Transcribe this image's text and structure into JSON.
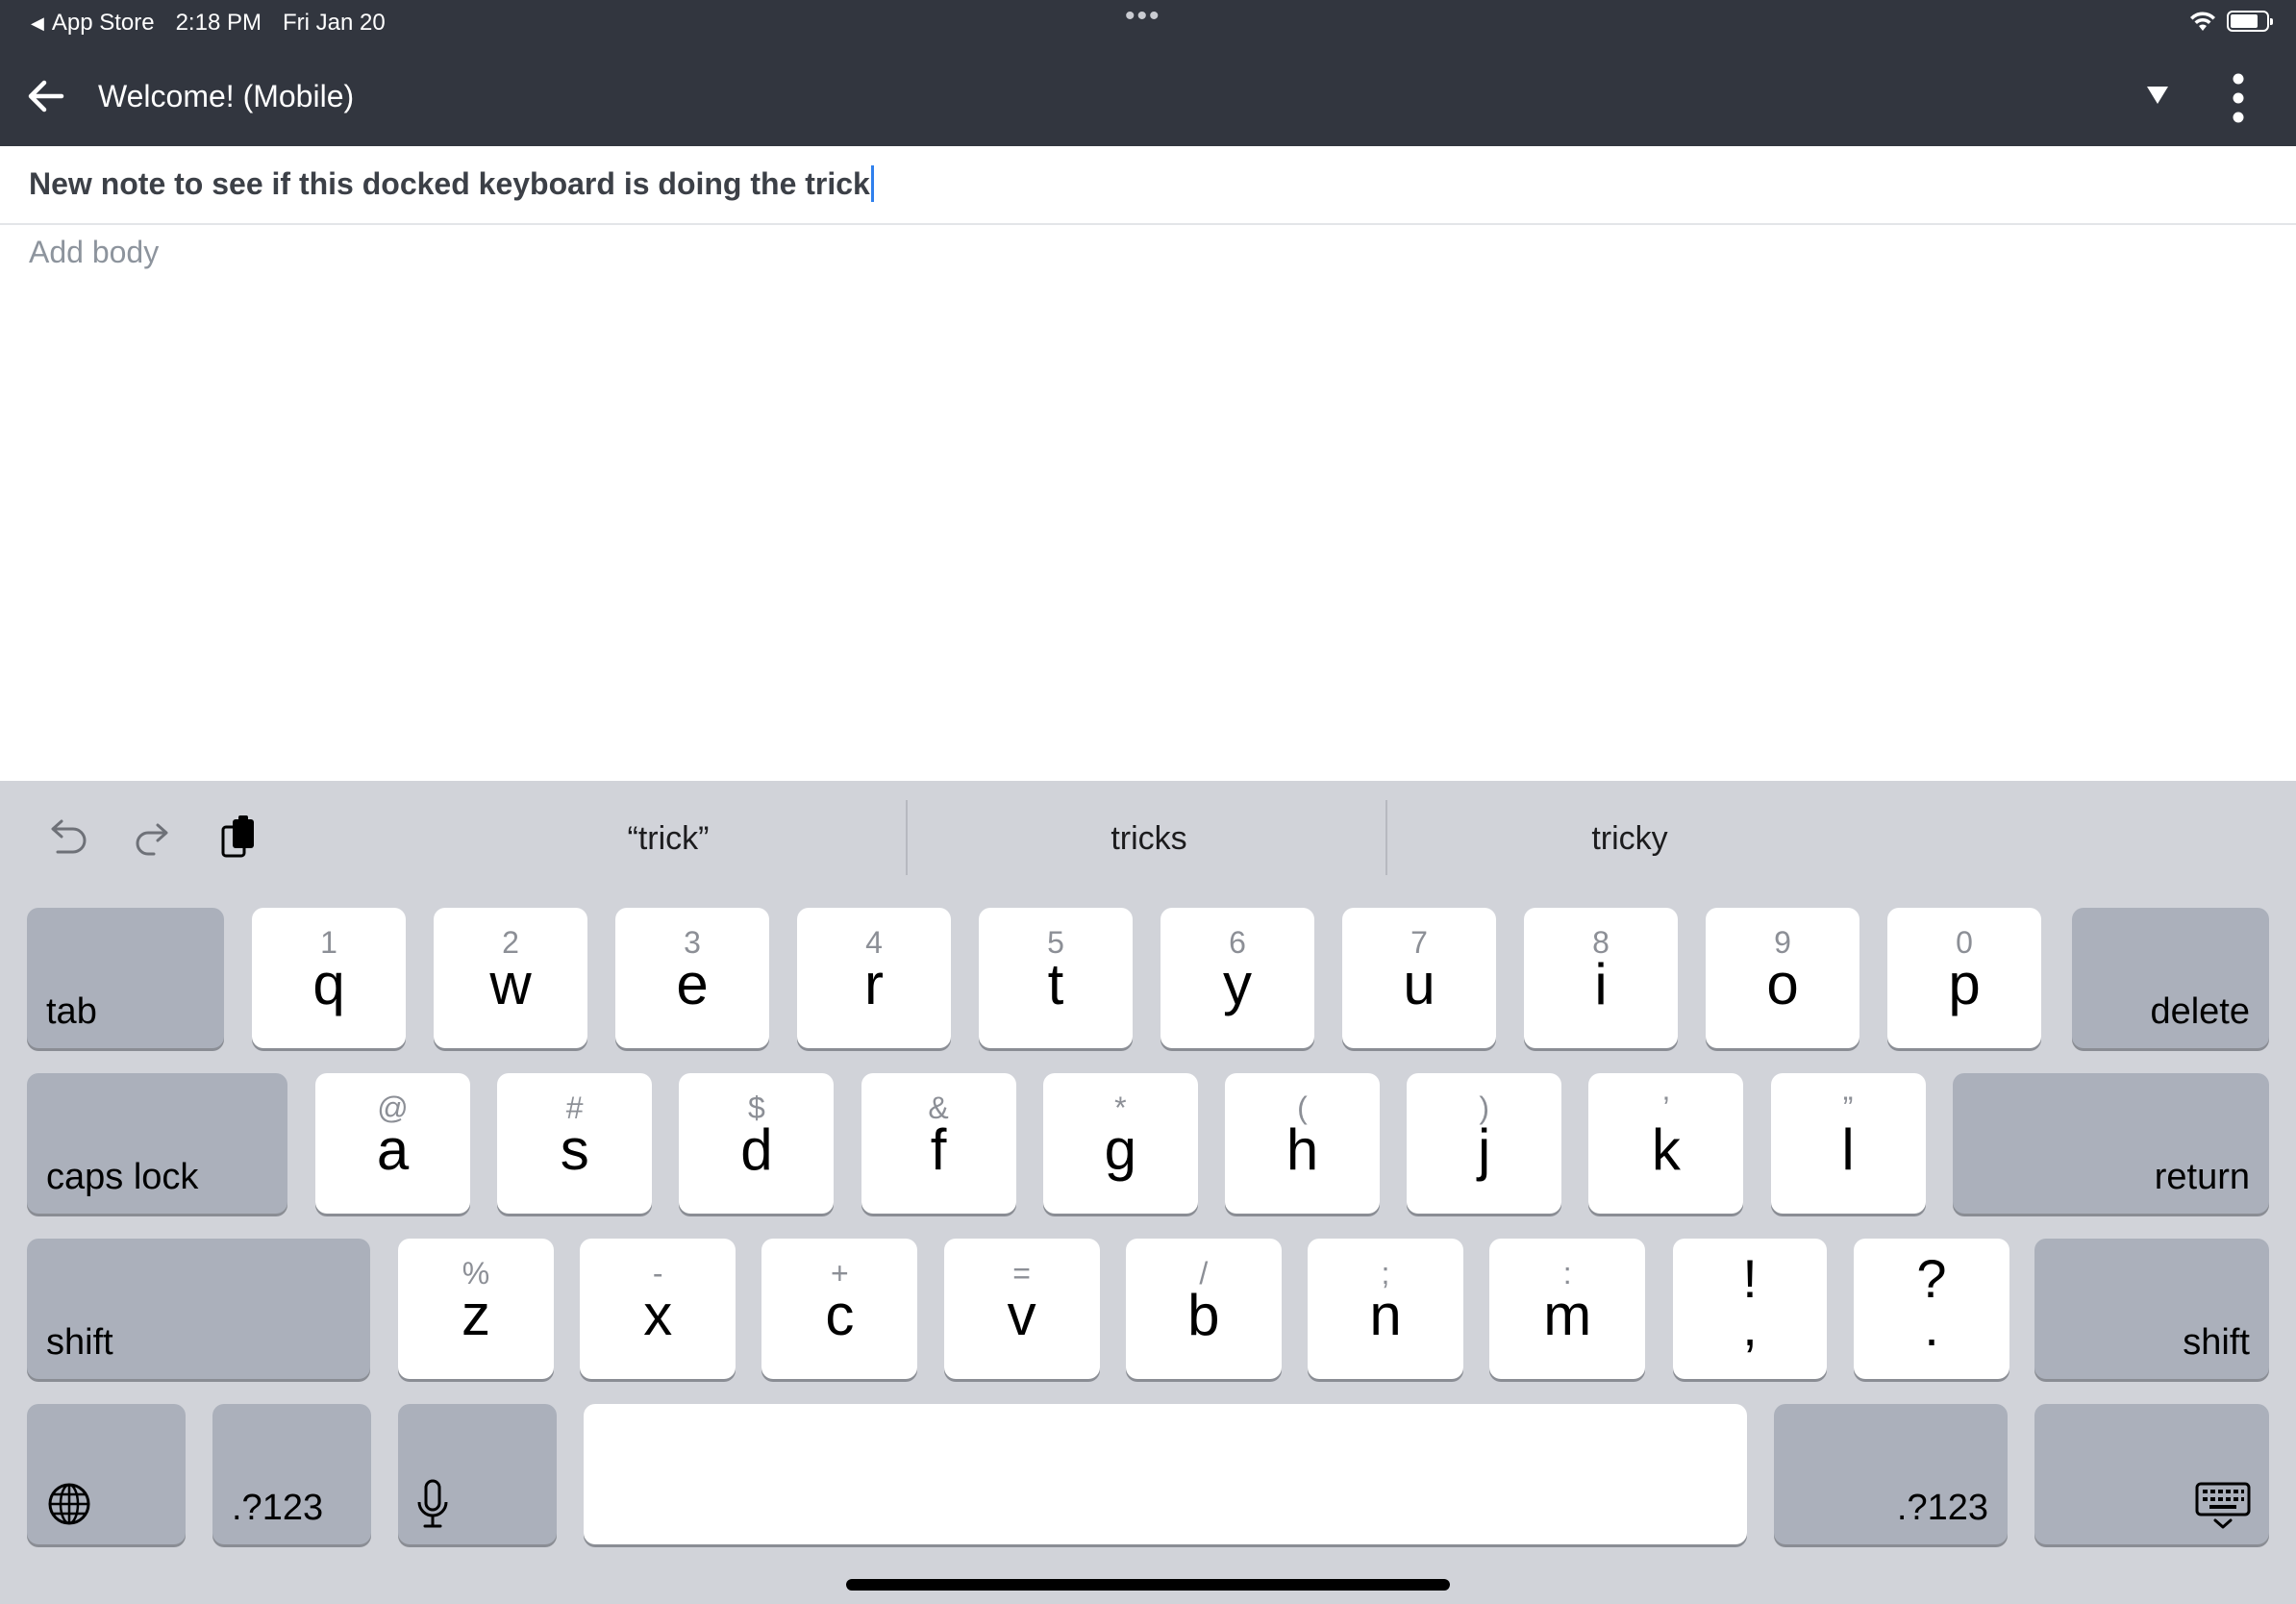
{
  "status_bar": {
    "back_app": "App Store",
    "time": "2:18 PM",
    "date": "Fri Jan 20",
    "multitask": "•••"
  },
  "header": {
    "title": "Welcome! (Mobile)",
    "icons": [
      "arrow-left-icon",
      "triangle-down-icon",
      "vertical-dots-icon"
    ]
  },
  "note": {
    "title": "New note to see if this docked keyboard is doing the trick",
    "body_placeholder": "Add body"
  },
  "keyboard": {
    "suggestions": [
      "“trick”",
      "tricks",
      "tricky"
    ],
    "rows": {
      "row1": [
        {
          "hint": "1",
          "char": "q"
        },
        {
          "hint": "2",
          "char": "w"
        },
        {
          "hint": "3",
          "char": "e"
        },
        {
          "hint": "4",
          "char": "r"
        },
        {
          "hint": "5",
          "char": "t"
        },
        {
          "hint": "6",
          "char": "y"
        },
        {
          "hint": "7",
          "char": "u"
        },
        {
          "hint": "8",
          "char": "i"
        },
        {
          "hint": "9",
          "char": "o"
        },
        {
          "hint": "0",
          "char": "p"
        }
      ],
      "row2": [
        {
          "hint": "@",
          "char": "a"
        },
        {
          "hint": "#",
          "char": "s"
        },
        {
          "hint": "$",
          "char": "d"
        },
        {
          "hint": "&",
          "char": "f"
        },
        {
          "hint": "*",
          "char": "g"
        },
        {
          "hint": "(",
          "char": "h"
        },
        {
          "hint": ")",
          "char": "j"
        },
        {
          "hint": "’",
          "char": "k"
        },
        {
          "hint": "”",
          "char": "l"
        }
      ],
      "row3": [
        {
          "hint": "%",
          "char": "z"
        },
        {
          "hint": "-",
          "char": "x"
        },
        {
          "hint": "+",
          "char": "c"
        },
        {
          "hint": "=",
          "char": "v"
        },
        {
          "hint": "/",
          "char": "b"
        },
        {
          "hint": ";",
          "char": "n"
        },
        {
          "hint": ":",
          "char": "m"
        }
      ],
      "row3_punct": [
        {
          "top": "!",
          "bottom": ","
        },
        {
          "top": "?",
          "bottom": "."
        }
      ]
    },
    "labels": {
      "tab": "tab",
      "delete": "delete",
      "caps_lock": "caps lock",
      "return": "return",
      "shift_left": "shift",
      "shift_right": "shift",
      "numbers_left": ".?123",
      "numbers_right": ".?123"
    },
    "icons": [
      "undo-icon",
      "redo-icon",
      "paste-icon",
      "globe-icon",
      "microphone-icon",
      "keyboard-dismiss-icon"
    ]
  },
  "colors": {
    "header_bg": "#32363f",
    "keyboard_bg": "#d1d3d9",
    "key_bg": "#ffffff",
    "modifier_key_bg": "#abb0bb",
    "caret": "#2f80ed"
  }
}
